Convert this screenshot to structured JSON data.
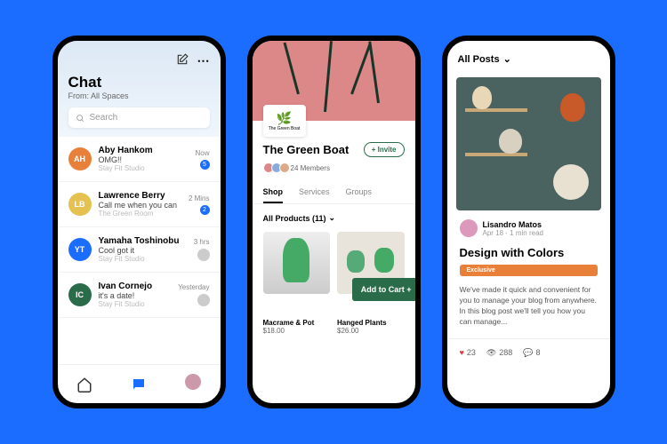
{
  "phone1": {
    "title": "Chat",
    "subtitle": "From: All Spaces",
    "search_placeholder": "Search",
    "rows": [
      {
        "initials": "AH",
        "color": "#e8803a",
        "name": "Aby Hankom",
        "msg": "OMG!!",
        "studio": "Stay Fit Studio",
        "time": "Now",
        "badge": "5"
      },
      {
        "initials": "LB",
        "color": "#e5c14f",
        "name": "Lawrence Berry",
        "msg": "Call me when you can",
        "studio": "The Green Room",
        "time": "2 Mins",
        "badge": "2"
      },
      {
        "initials": "YT",
        "color": "#1a6dff",
        "name": "Yamaha Toshinobu",
        "msg": "Cool got it",
        "studio": "Stay Fit Studio",
        "time": "3 hrs",
        "badge": ""
      },
      {
        "initials": "IC",
        "color": "#2a6b4a",
        "name": "Ivan Cornejo",
        "msg": "it's a date!",
        "studio": "Stay Fit Studio",
        "time": "Yesterday",
        "badge": ""
      }
    ]
  },
  "phone2": {
    "logo": "The Green Boat",
    "title": "The Green Boat",
    "invite": "+ Invite",
    "members": "24 Members",
    "tabs": [
      "Shop",
      "Services",
      "Groups"
    ],
    "filter": "All Products (11)",
    "products": [
      {
        "name": "Macrame & Pot",
        "price": "$18.00"
      },
      {
        "name": "Hanged Plants",
        "price": "$26.00"
      }
    ],
    "cart": "Add to Cart +"
  },
  "phone3": {
    "header": "All Posts",
    "author": "Lisandro Matos",
    "date": "Apr 18 · 1 min read",
    "title": "Design with Colors",
    "badge": "Exclusive",
    "body": "We've made it quick and convenient for you to manage your blog from anywhere. In this blog post we'll tell you how you can manage...",
    "likes": "23",
    "views": "288",
    "comments": "8"
  }
}
